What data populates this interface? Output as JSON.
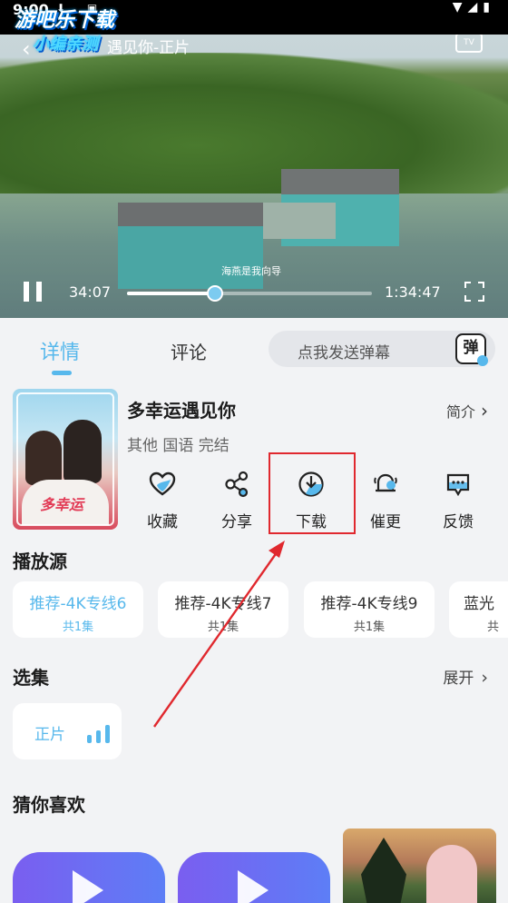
{
  "status_bar": {
    "time": "9:00"
  },
  "watermark": {
    "line1": "游吧乐下载",
    "line2": "小编亲测"
  },
  "video": {
    "title": "遇见你-正片",
    "tv_label": "TV",
    "subtitle_text": "海燕是我向导",
    "current_time": "34:07",
    "total_time": "1:34:47",
    "progress": 0.36
  },
  "tabs": {
    "detail": "详情",
    "comment": "评论"
  },
  "danmu": {
    "placeholder": "点我发送弹幕",
    "icon_text": "弹"
  },
  "show": {
    "title": "多幸运遇见你",
    "meta": "其他 国语 完结",
    "intro": "简介",
    "poster_title": "多幸运"
  },
  "actions": [
    {
      "label": "收藏",
      "icon": "heart-icon"
    },
    {
      "label": "分享",
      "icon": "share-icon"
    },
    {
      "label": "下载",
      "icon": "download-icon"
    },
    {
      "label": "催更",
      "icon": "bell-icon"
    },
    {
      "label": "反馈",
      "icon": "feedback-icon"
    }
  ],
  "sources": {
    "title": "播放源",
    "items": [
      {
        "name": "推荐-4K专线6",
        "episodes": "共1集",
        "active": true
      },
      {
        "name": "推荐-4K专线7",
        "episodes": "共1集",
        "active": false
      },
      {
        "name": "推荐-4K专线9",
        "episodes": "共1集",
        "active": false
      },
      {
        "name": "蓝光",
        "episodes": "共",
        "active": false
      }
    ]
  },
  "episodes": {
    "title": "选集",
    "expand": "展开",
    "items": [
      {
        "name": "正片"
      }
    ]
  },
  "recommend": {
    "title": "猜你喜欢"
  },
  "colors": {
    "accent": "#57b8ec",
    "highlight": "#e0282e"
  }
}
